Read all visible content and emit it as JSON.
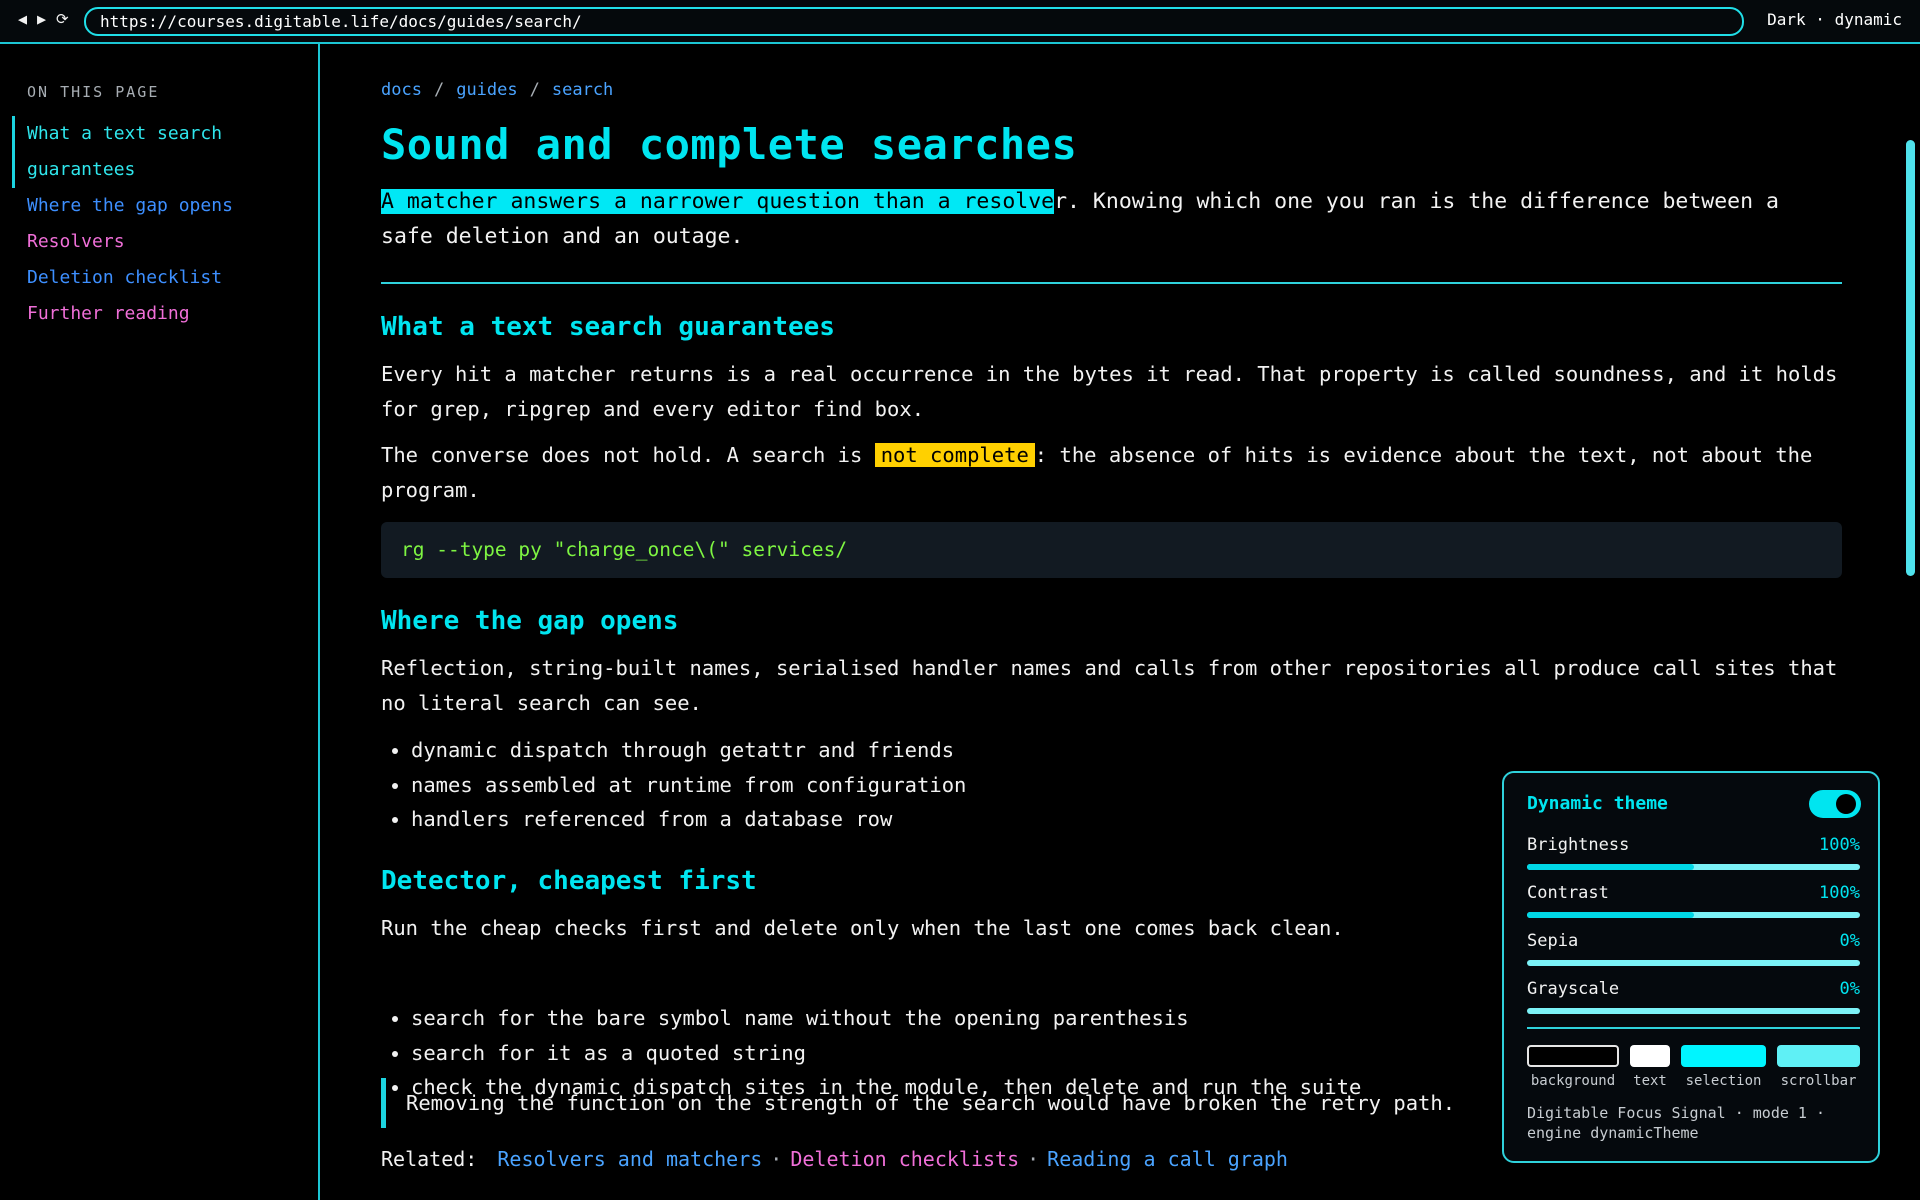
{
  "browser": {
    "back_icon": "◀",
    "forward_icon": "▶",
    "reload_icon": "⟳",
    "url": "https://courses.digitable.life/docs/guides/search/",
    "mode_label": "Dark · dynamic"
  },
  "sidebar": {
    "heading": "ON THIS PAGE",
    "items": [
      {
        "label": "What a text search guarantees",
        "color": "#2fe6ec",
        "active": true
      },
      {
        "label": "Where the gap opens",
        "color": "#3d8fff"
      },
      {
        "label": "Resolvers",
        "color": "#f06fd8"
      },
      {
        "label": "Deletion checklist",
        "color": "#3d8fff"
      },
      {
        "label": "Further reading",
        "color": "#f06fd8"
      }
    ]
  },
  "breadcrumb": [
    "docs",
    "guides",
    "search"
  ],
  "page": {
    "title": "Sound and complete searches",
    "lead_highlight": "A matcher answers a narrower question than a resolve",
    "lead_rest": "r. Knowing which one you ran is the difference between a safe deletion and an outage."
  },
  "section1": {
    "heading": "What a text search guarantees",
    "para1": "Every hit a matcher returns is a real occurrence in the bytes it read. That property is called soundness, and it holds for grep, ripgrep and every editor find box.",
    "para2_before": "The converse does not hold. A search is ",
    "para2_highlight": "not complete",
    "para2_after": ": the absence of hits is evidence about the text, not about the program.",
    "code": "rg --type py \"charge_once\\(\" services/"
  },
  "section2": {
    "heading": "Where the gap opens",
    "para": "Reflection, string-built names, serialised handler names and calls from other repositories all produce call sites that no literal search can see.",
    "bullets": [
      "dynamic dispatch through getattr and friends",
      "names assembled at runtime from configuration",
      "handlers referenced from a database row"
    ]
  },
  "section3": {
    "heading": "Detector, cheapest first",
    "para": "Run the cheap checks first and delete only when the last one comes back clean.",
    "bullets": [
      "search for the bare symbol name without the opening parenthesis",
      "search for it as a quoted string",
      "check the dynamic dispatch sites in the module, then delete and run the suite"
    ],
    "callout": "Removing the function on the strength of the search would have broken the retry path."
  },
  "related": {
    "label": "Related:",
    "links": [
      {
        "label": "Resolvers and matchers",
        "color": "#4aa3ff"
      },
      {
        "label": "Deletion checklists",
        "color": "#f06fd8"
      },
      {
        "label": "Reading a call graph",
        "color": "#4aa3ff"
      }
    ]
  },
  "theme_panel": {
    "title": "Dynamic theme",
    "enabled": true,
    "sliders": [
      {
        "label": "Brightness",
        "value": "100%",
        "fraction": 0.5
      },
      {
        "label": "Contrast",
        "value": "100%",
        "fraction": 0.5
      },
      {
        "label": "Sepia",
        "value": "0%",
        "fraction": 0
      },
      {
        "label": "Grayscale",
        "value": "0%",
        "fraction": 0
      }
    ],
    "swatches": [
      {
        "label": "background",
        "color": "#000000"
      },
      {
        "label": "text",
        "color": "#ffffff"
      },
      {
        "label": "selection",
        "color": "#00f5ff"
      },
      {
        "label": "scrollbar",
        "color": "#5ff0f5"
      }
    ],
    "footer": "Digitable Focus Signal · mode 1 · engine dynamicTheme"
  }
}
